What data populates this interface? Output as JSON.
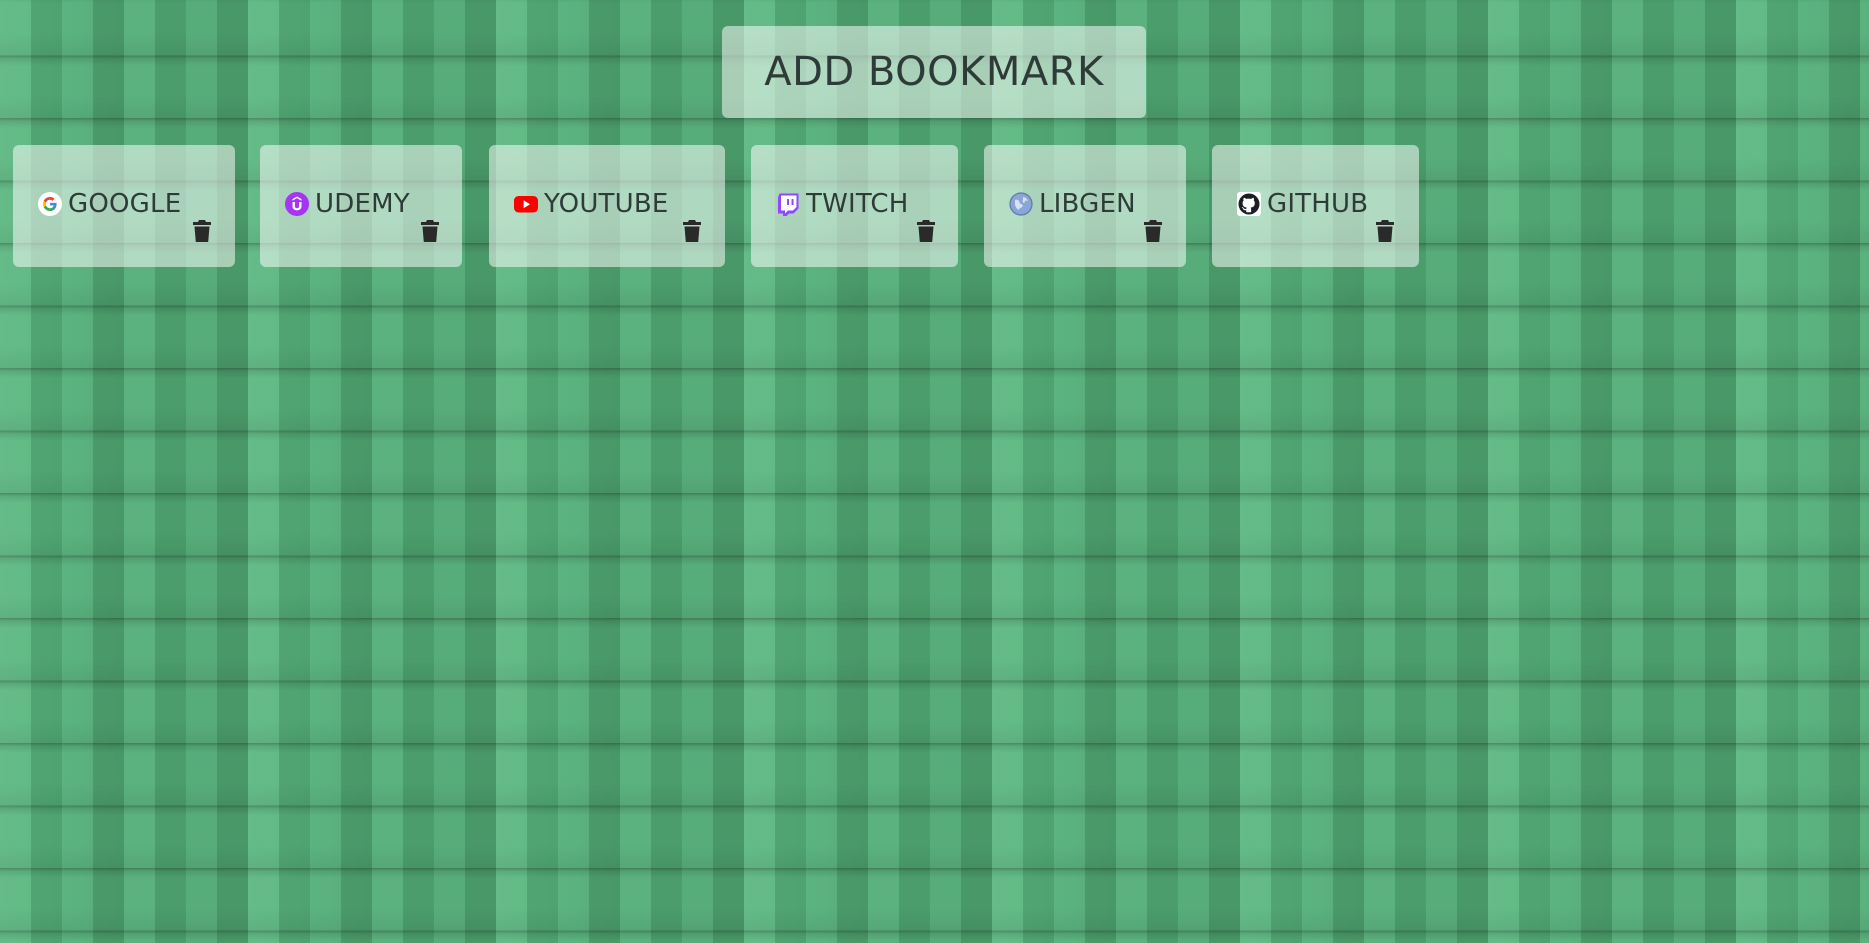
{
  "header": {
    "add_button_label": "ADD BOOKMARK"
  },
  "bookmarks": [
    {
      "label": "GOOGLE",
      "icon": "google-icon"
    },
    {
      "label": "UDEMY",
      "icon": "udemy-icon"
    },
    {
      "label": "YOUTUBE",
      "icon": "youtube-icon"
    },
    {
      "label": "TWITCH",
      "icon": "twitch-icon"
    },
    {
      "label": "LIBGEN",
      "icon": "globe-icon"
    },
    {
      "label": "GITHUB",
      "icon": "github-icon"
    }
  ],
  "colors": {
    "background_green": "#55ac78",
    "card_overlay": "rgba(255,255,255,0.52)",
    "text": "#2f3b38",
    "youtube_red": "#ff0000",
    "twitch_purple": "#9146ff",
    "udemy_purple": "#a435f0"
  }
}
